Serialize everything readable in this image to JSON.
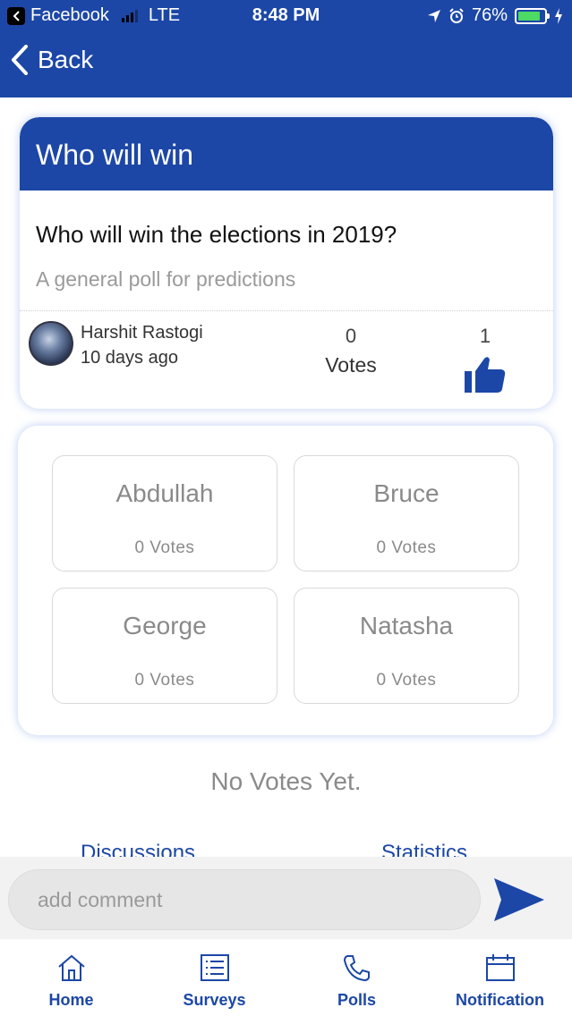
{
  "status_bar": {
    "app": "Facebook",
    "network": "LTE",
    "time": "8:48 PM",
    "battery": "76%"
  },
  "header": {
    "back_label": "Back"
  },
  "poll": {
    "title": "Who will win",
    "question": "Who will win the elections in 2019?",
    "description": "A general poll for predictions",
    "author": "Harshit Rastogi",
    "posted": "10 days ago",
    "votes_count": "0",
    "votes_label": "Votes",
    "likes_count": "1"
  },
  "options": [
    {
      "name": "Abdullah",
      "votes": "0 Votes"
    },
    {
      "name": "Bruce",
      "votes": "0 Votes"
    },
    {
      "name": "George",
      "votes": "0 Votes"
    },
    {
      "name": "Natasha",
      "votes": "0 Votes"
    }
  ],
  "no_votes_text": "No Votes Yet.",
  "tabs": [
    "Discussions",
    "Statistics"
  ],
  "comment": {
    "placeholder": "add comment"
  },
  "bottom_nav": {
    "items": [
      {
        "label": "Home",
        "icon": "home-icon"
      },
      {
        "label": "Surveys",
        "icon": "list-icon"
      },
      {
        "label": "Polls",
        "icon": "phone-icon"
      },
      {
        "label": "Notification",
        "icon": "calendar-icon"
      }
    ]
  },
  "colors": {
    "brand": "#1c47a6",
    "muted": "#8a8a8a"
  }
}
